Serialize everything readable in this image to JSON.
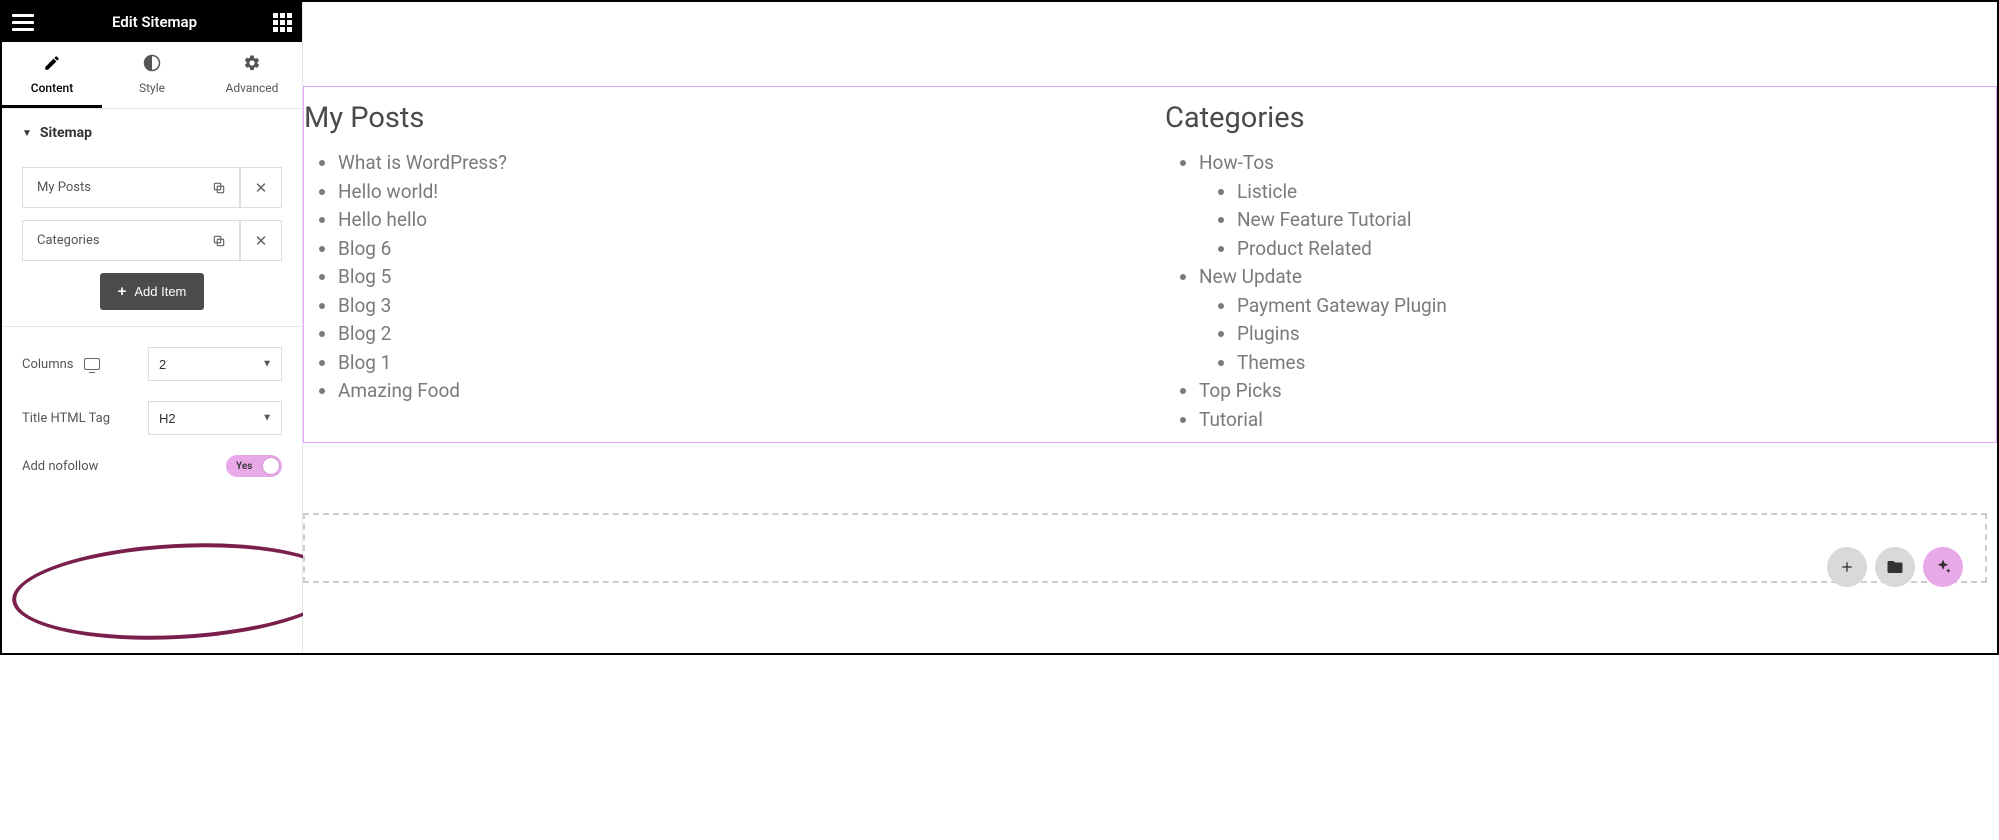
{
  "header": {
    "title": "Edit Sitemap"
  },
  "tabs": {
    "content": "Content",
    "style": "Style",
    "advanced": "Advanced"
  },
  "section": {
    "title": "Sitemap"
  },
  "items": [
    {
      "label": "My Posts"
    },
    {
      "label": "Categories"
    }
  ],
  "add_item_label": "Add Item",
  "controls": {
    "columns_label": "Columns",
    "columns_value": "2",
    "title_tag_label": "Title HTML Tag",
    "title_tag_value": "H2",
    "nofollow_label": "Add nofollow",
    "nofollow_value": "Yes"
  },
  "preview": {
    "posts_heading": "My Posts",
    "posts": [
      "What is WordPress?",
      "Hello world!",
      "Hello hello",
      "Blog 6",
      "Blog 5",
      "Blog 3",
      "Blog 2",
      "Blog 1",
      "Amazing Food"
    ],
    "cats_heading": "Categories",
    "cats": [
      {
        "label": "How-Tos",
        "children": [
          "Listicle",
          "New Feature Tutorial",
          "Product Related"
        ]
      },
      {
        "label": "New Update",
        "children": [
          "Payment Gateway Plugin",
          "Plugins",
          "Themes"
        ]
      },
      {
        "label": "Top Picks"
      },
      {
        "label": "Tutorial"
      }
    ]
  }
}
